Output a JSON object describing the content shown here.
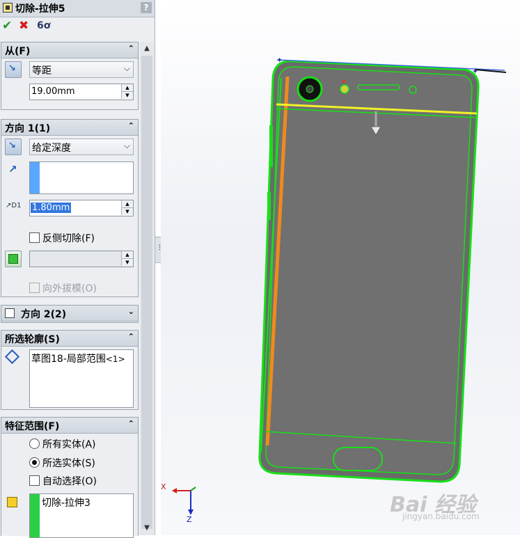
{
  "title_bar": {
    "title": "切除-拉伸5",
    "help": "?"
  },
  "actions": {
    "ok": "✔",
    "cancel": "✖",
    "preview": "6ơ"
  },
  "group_from": {
    "title": "从(F)",
    "start_condition": "等距",
    "offset_value": "19.00mm"
  },
  "group_direction1": {
    "title": "方向 1(1)",
    "end_condition": "给定深度",
    "depth_value": "1.80mm",
    "flip_side_label": "反侧切除(F)",
    "draft_label": "向外拔模(O)"
  },
  "group_direction2": {
    "title": "方向 2(2)"
  },
  "group_contours": {
    "title": "所选轮廓(S)",
    "item_prefix": "草图18-局部范围",
    "item_suffix": "<1>"
  },
  "group_scope": {
    "title": "特征范围(F)",
    "all_bodies": "所有实体(A)",
    "selected_bodies": "所选实体(S)",
    "auto_select": "自动选择(O)",
    "body_item": "切除-拉伸3"
  },
  "triad": {
    "x": "X",
    "z": "Z"
  },
  "watermark": {
    "main": "Bai 经验",
    "sub": "jingyan.baidu.com"
  },
  "colors": {
    "sketch_green": "#17e017",
    "highlight_orange": "#f08a1c",
    "body_gray": "#6e6e6e",
    "selection_yellow": "#f2f227"
  }
}
